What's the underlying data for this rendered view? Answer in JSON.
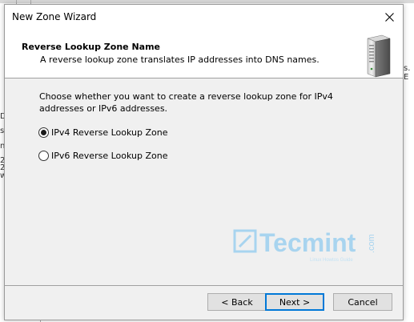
{
  "window": {
    "title": "New Zone Wizard",
    "close_icon": "close-icon"
  },
  "header": {
    "title": "Reverse Lookup Zone Name",
    "subtitle": "A reverse lookup zone translates IP addresses into DNS names.",
    "icon": "server-icon"
  },
  "main": {
    "instruction": "Choose whether you want to create a reverse lookup zone for IPv4 addresses or IPv6 addresses.",
    "options": [
      {
        "label": "IPv4 Reverse Lookup Zone",
        "selected": true
      },
      {
        "label": "IPv6 Reverse Lookup Zone",
        "selected": false
      }
    ]
  },
  "watermark": {
    "brand": "Tecmint",
    "suffix": ".com",
    "tagline": "Linux Howtos Guide"
  },
  "footer": {
    "back_label": "< Back",
    "next_label": "Next >",
    "cancel_label": "Cancel"
  },
  "background": {
    "fragments": [
      "s. E",
      "D",
      "s",
      "n",
      "2",
      "2",
      "w"
    ]
  },
  "colors": {
    "dialog_bg": "#f0f0f0",
    "header_bg": "#ffffff",
    "focus_border": "#0078d7",
    "watermark": "#a8d4ef"
  }
}
